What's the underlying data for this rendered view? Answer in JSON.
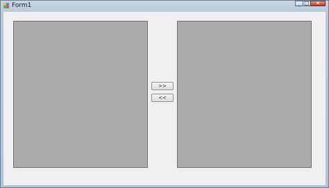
{
  "window": {
    "title": "Form1"
  },
  "caption": {
    "minimize_glyph": "_",
    "maximize_glyph": "□",
    "close_glyph": "✕"
  },
  "buttons": {
    "move_right_label": ">>",
    "move_left_label": "<<"
  },
  "colors": {
    "panel_fill": "#ababab",
    "form_background": "#f0f0f0",
    "title_bar": "#b8c9dc"
  },
  "icons": [
    "app-icon",
    "minimize-icon",
    "maximize-icon",
    "close-icon"
  ]
}
